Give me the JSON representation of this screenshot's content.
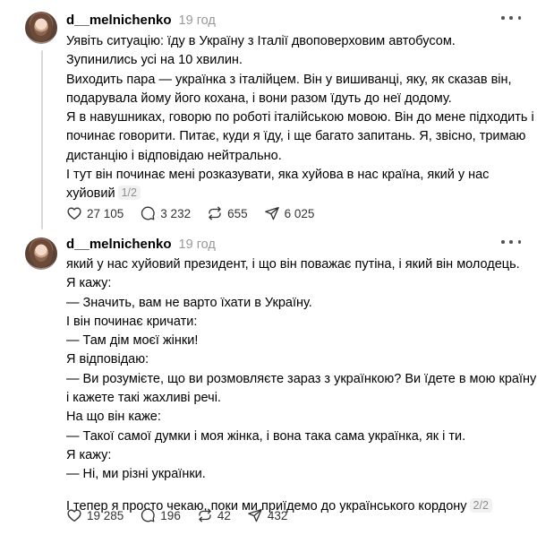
{
  "posts": [
    {
      "username": "d__melnichenko",
      "time": "19 год",
      "lines": [
        "Уявіть ситуацію: їду в Україну з Італії двоповерховим автобусом.",
        "Зупинились усі на 10 хвилин.",
        "Виходить пара — українка з італійцем. Він у вишиванці, яку, як сказав він,",
        "подарувала йому його кохана, і вони разом їдуть до неї додому.",
        "Я в навушниках, говорю по роботі італійською мовою. Він до мене підходить і",
        "починає говорити. Питає, куди я їду, і ще багато запитань. Я, звісно, тримаю",
        "дистанцію і відповідаю нейтрально.",
        "І тут він починає мені розказувати, яка хуйова в нас країна, який у нас",
        "хуйовий"
      ],
      "page_indicator": "1/2",
      "stats": {
        "likes": "27 105",
        "comments": "3 232",
        "reposts": "655",
        "shares": "6 025"
      }
    },
    {
      "username": "d__melnichenko",
      "time": "19 год",
      "lines": [
        "який у нас хуйовий президент, і що він поважає путіна, і який він молодець.",
        "Я кажу:",
        "— Значить, вам не варто їхати в Україну.",
        "І він починає кричати:",
        "— Там дім моєї жінки!",
        "Я відповідаю:",
        "— Ви розумієте, що ви розмовляєте зараз з українкою? Ви їдете в мою країну",
        "і кажете такі жахливі речі.",
        "На що він каже:",
        "— Такої самої думки і моя жінка, і вона така сама українка, як і ти.",
        "Я кажу:",
        "— Ні, ми різні українки.",
        "",
        "І тепер я просто чекаю, поки ми приїдемо до українського кордону"
      ],
      "page_indicator": "2/2",
      "stats": {
        "likes": "19 285",
        "comments": "196",
        "reposts": "42",
        "shares": "432"
      }
    }
  ],
  "icons": {
    "like": "heart-icon",
    "comment": "comment-bubble-icon",
    "repost": "repost-arrows-icon",
    "share": "send-plane-icon",
    "more": "more-dots-icon"
  },
  "colors": {
    "muted": "#999999",
    "thread_line": "#d9d9d9",
    "text": "#000000"
  }
}
